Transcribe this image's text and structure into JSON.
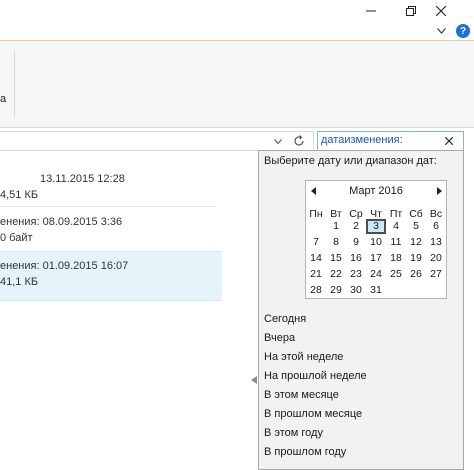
{
  "window": {
    "minimize_icon": "minimize-icon",
    "maximize_icon": "restore-icon",
    "close_icon": "close-icon"
  },
  "ribbon": {
    "partial_label": "а",
    "help_label": "?"
  },
  "address_bar": {
    "dropdown_icon": "chevron-down-icon",
    "refresh_icon": "refresh-icon"
  },
  "search": {
    "value": "датаизменения:",
    "clear_icon": "close-icon"
  },
  "files": [
    {
      "date_line": "13.11.2015 12:28",
      "size_line": "4,51 КБ"
    },
    {
      "date_line": "енения: 08.09.2015 3:36",
      "size_line": "0 байт"
    },
    {
      "date_line": "енения: 01.09.2015 16:07",
      "size_line": "41,1 КБ"
    }
  ],
  "date_picker": {
    "prompt": "Выберите дату или диапазон дат:",
    "month_label": "Март 2016",
    "weekdays": [
      "Пн",
      "Вт",
      "Ср",
      "Чт",
      "Пт",
      "Сб",
      "Вс"
    ],
    "weeks": [
      [
        "",
        "1",
        "2",
        "3",
        "4",
        "5",
        "6"
      ],
      [
        "7",
        "8",
        "9",
        "10",
        "11",
        "12",
        "13"
      ],
      [
        "14",
        "15",
        "16",
        "17",
        "18",
        "19",
        "20"
      ],
      [
        "21",
        "22",
        "23",
        "24",
        "25",
        "26",
        "27"
      ],
      [
        "28",
        "29",
        "30",
        "31",
        "",
        "",
        ""
      ]
    ],
    "today": "3",
    "options": [
      "Сегодня",
      "Вчера",
      "На этой неделе",
      "На прошлой неделе",
      "В этом месяце",
      "В прошлом месяце",
      "В этом году",
      "В прошлом году"
    ]
  },
  "colors": {
    "accent": "#1e6fd9",
    "selection": "#e5f3fb",
    "search_text": "#1a56c4"
  }
}
